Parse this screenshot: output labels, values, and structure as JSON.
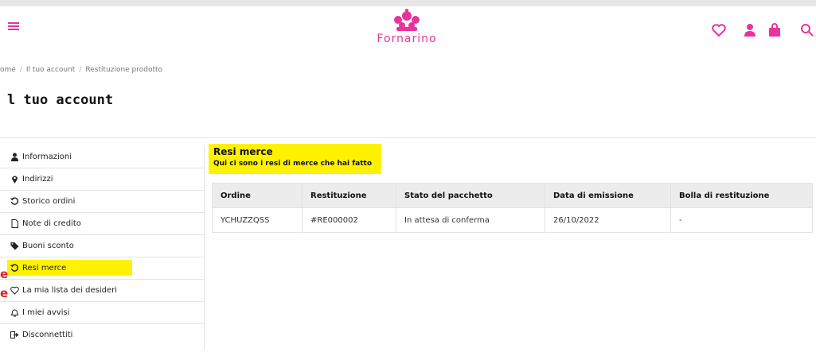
{
  "header": {
    "logo_text": "Fornarino",
    "brand_color": "#e8339d",
    "icons": [
      "menu-icon",
      "heart-icon",
      "user-icon",
      "bag-icon",
      "search-icon"
    ]
  },
  "breadcrumb": [
    "ome",
    "Il tuo account",
    "Restituzione prodotto"
  ],
  "page_title": "l tuo account",
  "sidebar": {
    "items": [
      {
        "label": "Informazioni",
        "icon": "user-icon"
      },
      {
        "label": "Indirizzi",
        "icon": "map-pin-icon"
      },
      {
        "label": "Storico ordini",
        "icon": "history-icon"
      },
      {
        "label": "Note di credito",
        "icon": "file-icon"
      },
      {
        "label": "Buoni sconto",
        "icon": "tag-icon"
      },
      {
        "label": "Resi merce",
        "icon": "undo-icon",
        "active": true
      },
      {
        "label": "La mia lista dei desideri",
        "icon": "heart-outline-icon"
      },
      {
        "label": "I miei avvisi",
        "icon": "bell-icon"
      },
      {
        "label": "Disconnettiti",
        "icon": "sign-out-icon"
      }
    ],
    "highlight_color": "#fff200"
  },
  "side_marks": [
    "e",
    "e"
  ],
  "content": {
    "title": "Resi merce",
    "subtitle": "Qui ci sono i resi di merce che hai fatto"
  },
  "table": {
    "headers": [
      "Ordine",
      "Restituzione",
      "Stato del pacchetto",
      "Data di emissione",
      "Bolla di restituzione"
    ],
    "rows": [
      [
        "YCHUZZQSS",
        "#RE000002",
        "In attesa di conferma",
        "26/10/2022",
        "-"
      ]
    ]
  }
}
